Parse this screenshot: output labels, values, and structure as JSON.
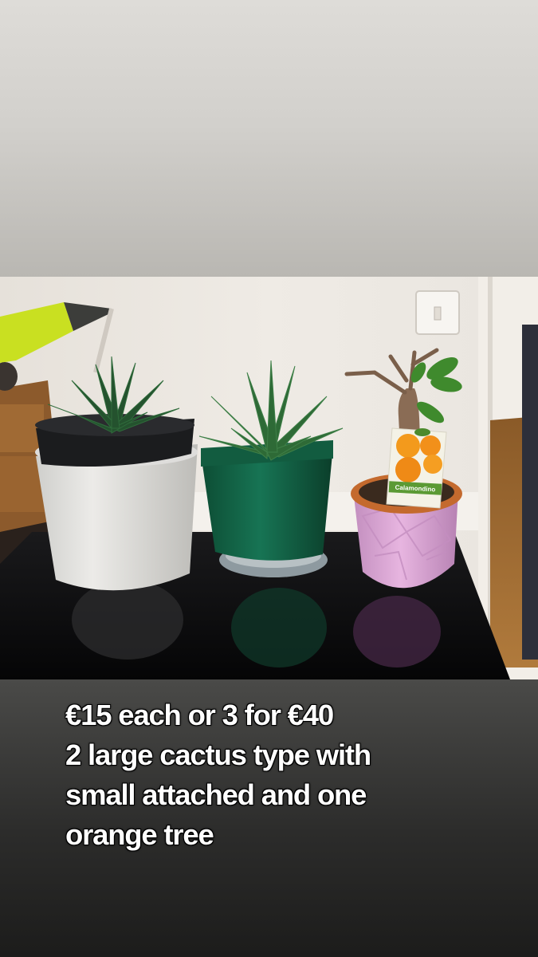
{
  "caption": {
    "lines": [
      "€15 each or 3 for €40",
      "2 large cactus type with",
      "small attached and one",
      "orange tree"
    ]
  },
  "photo": {
    "plant_tag_label": "Calamondino"
  },
  "colors": {
    "top_fill": "#d2d0cc",
    "bottom_fill": "#2c2c2b",
    "caption_text": "#ffffff"
  }
}
